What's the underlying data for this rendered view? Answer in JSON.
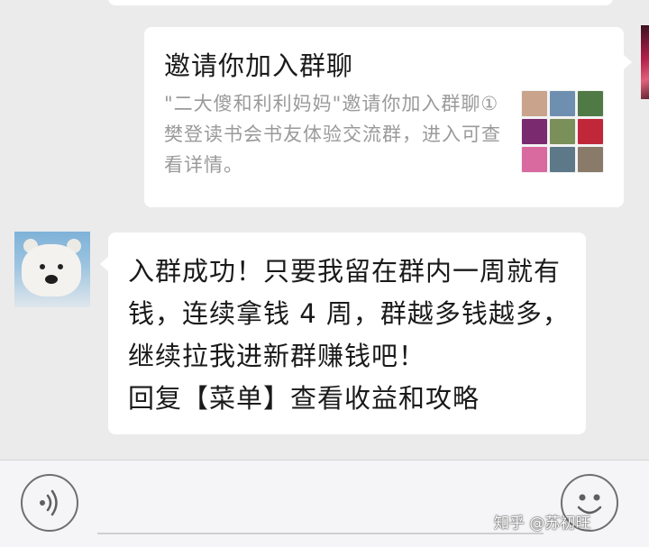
{
  "invite_card": {
    "title": "邀请你加入群聊",
    "description": "\"二大傻和利利妈妈\"邀请你加入群聊①樊登读书会书友体验交流群，进入可查看详情。",
    "thumbnail_cells": [
      {
        "icon": "avatar-photo",
        "color": "#c9a38b"
      },
      {
        "icon": "avatar-photo",
        "color": "#6f8fb0"
      },
      {
        "icon": "avatar-photo",
        "color": "#4f7a45"
      },
      {
        "icon": "avatar-logo",
        "color": "#7a2a6e"
      },
      {
        "icon": "avatar-photo",
        "color": "#7a8f5a"
      },
      {
        "icon": "avatar-logo",
        "color": "#c0283a"
      },
      {
        "icon": "avatar-photo",
        "color": "#d86aa0"
      },
      {
        "icon": "avatar-photo",
        "color": "#5d7888"
      },
      {
        "icon": "avatar-photo",
        "color": "#8a7a6a"
      }
    ]
  },
  "message": {
    "text": "入群成功！只要我留在群内一周就有钱，连续拿钱 4 周，群越多钱越多，继续拉我进新群赚钱吧！\n回复【菜单】查看收益和攻略"
  },
  "watermark": {
    "text": "知乎 @苏初旺"
  },
  "colors": {
    "background": "#ebebeb",
    "bubble": "#ffffff",
    "secondary_text": "#9a9a9a"
  }
}
